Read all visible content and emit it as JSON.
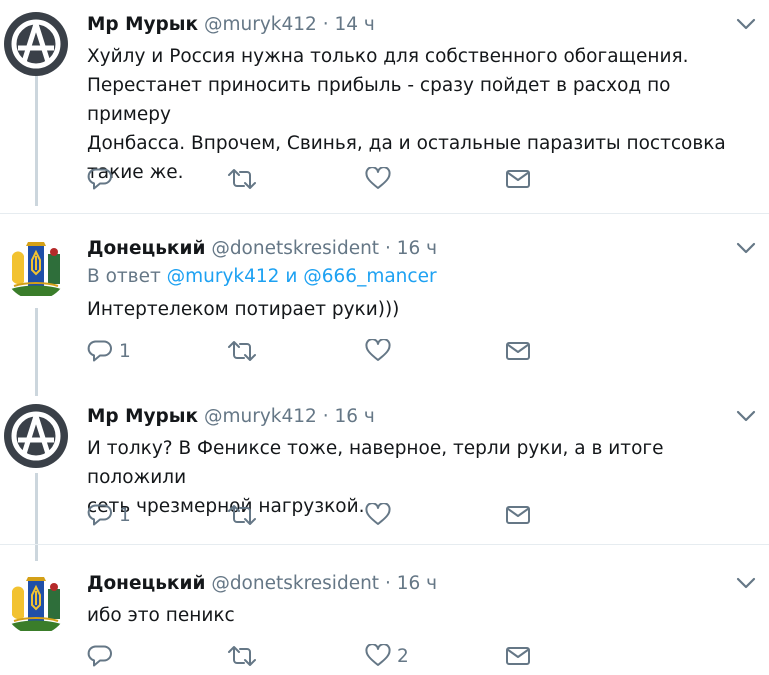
{
  "tweets": [
    {
      "name": "Мр Мурык",
      "handle": "@muryk412",
      "dot": "·",
      "time": "14 ч",
      "text_lines": [
        "Хуйлу и Россия нужна только для собственного обогащения.",
        "Перестанет приносить прибыль - сразу пойдет в расход по примеру",
        "Донбасса. Впрочем, Свинья, да и остальные паразиты постсовка",
        "такие же."
      ],
      "reply_count": "",
      "retweet_count": "",
      "like_count": ""
    },
    {
      "name": "Донецький",
      "handle": "@donetskresident",
      "dot": "·",
      "time": "16 ч",
      "reply_prefix": "В ответ",
      "reply_user1": "@muryk412",
      "reply_and": "и",
      "reply_user2": "@666_mancer",
      "text_lines": [
        "Интертелеком потирает руки)))"
      ],
      "reply_count": "1",
      "retweet_count": "",
      "like_count": ""
    },
    {
      "name": "Мр Мурык",
      "handle": "@muryk412",
      "dot": "·",
      "time": "16 ч",
      "text_lines": [
        "И толку? В Фениксе тоже, наверное, терли руки, а в итоге положили",
        "сеть чрезмерной нагрузкой."
      ],
      "reply_count": "1",
      "retweet_count": "",
      "like_count": ""
    },
    {
      "name": "Донецький",
      "handle": "@donetskresident",
      "dot": "·",
      "time": "16 ч",
      "text_lines": [
        "ибо это пеникс"
      ],
      "reply_count": "",
      "retweet_count": "",
      "like_count": "2"
    }
  ],
  "icons": {
    "reply": "reply-icon",
    "retweet": "retweet-icon",
    "like": "heart-icon",
    "dm": "envelope-icon",
    "more": "chevron-down-icon",
    "avatar_anarchy": "anarchy-symbol-icon",
    "avatar_coat": "coat-of-arms-icon"
  },
  "colors": {
    "text": "#14171a",
    "secondary": "#657786",
    "link": "#1da1f2",
    "separator": "#e6ecf0",
    "thread_line": "#ccd6dd"
  }
}
